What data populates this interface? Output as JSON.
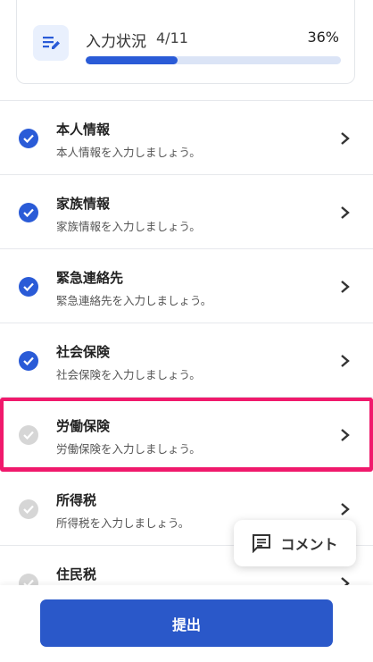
{
  "progress": {
    "title": "入力状況",
    "count": "4/11",
    "percent_label": "36%",
    "percent": 36,
    "icon": "form-edit-icon"
  },
  "items": [
    {
      "title": "本人情報",
      "subtitle": "本人情報を入力しましょう。",
      "done": true
    },
    {
      "title": "家族情報",
      "subtitle": "家族情報を入力しましょう。",
      "done": true
    },
    {
      "title": "緊急連絡先",
      "subtitle": "緊急連絡先を入力しましょう。",
      "done": true
    },
    {
      "title": "社会保険",
      "subtitle": "社会保険を入力しましょう。",
      "done": true
    },
    {
      "title": "労働保険",
      "subtitle": "労働保険を入力しましょう。",
      "done": false,
      "highlighted": true
    },
    {
      "title": "所得税",
      "subtitle": "所得税を入力しましょう。",
      "done": false
    },
    {
      "title": "住民税",
      "subtitle": "",
      "done": false
    }
  ],
  "comment_button": {
    "label": "コメント",
    "icon": "comment-icon"
  },
  "submit_button": {
    "label": "提出"
  },
  "colors": {
    "accent": "#2a5bd7",
    "highlight": "#f0196c",
    "pending": "#d6d6d6"
  }
}
